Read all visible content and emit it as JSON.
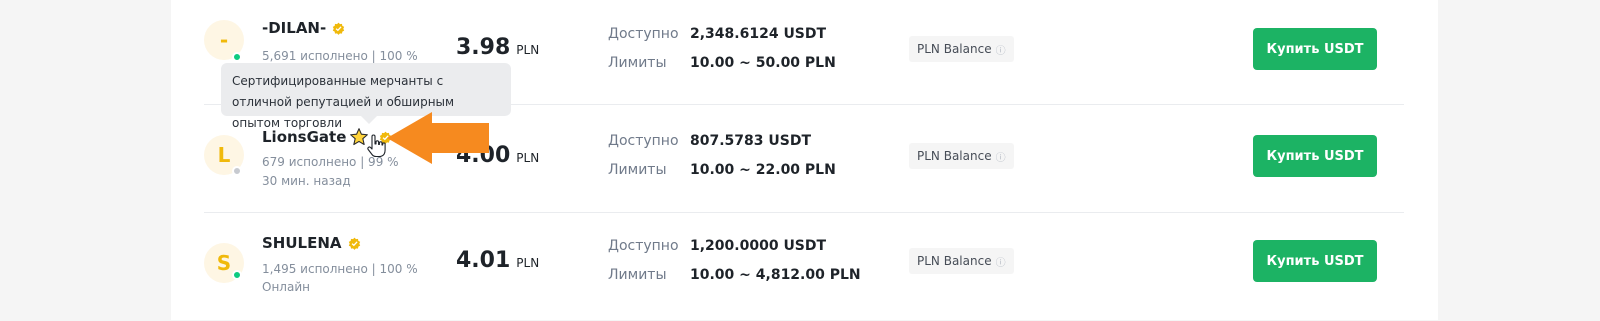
{
  "colors": {
    "accent_green": "#1cb364",
    "badge_gold": "#f0b90b",
    "online": "#0ecb81",
    "offline": "#c7cad0",
    "annotation_arrow": "#f68a1f"
  },
  "labels": {
    "available": "Доступно",
    "limits": "Лимиты",
    "buy_button": "Купить USDT",
    "currency": "PLN",
    "info_icon": "ⓘ"
  },
  "tooltip": {
    "text": "Сертифицированные мерчанты с отличной репутацией и обширным опытом торговли"
  },
  "merchants": [
    {
      "initial": "-",
      "name": "-DILAN-",
      "status": "online",
      "has_star": false,
      "stats": "5,691 исполнено  |  100 %",
      "activity": "",
      "price": "3.98",
      "available": "2,348.6124 USDT",
      "limits": "10.00 ~ 50.00 PLN",
      "payment": "PLN Balance"
    },
    {
      "initial": "L",
      "name": "LionsGate",
      "status": "offline",
      "has_star": true,
      "stats": "679 исполнено  |  99 %",
      "activity": "30 мин. назад",
      "price": "4.00",
      "available": "807.5783 USDT",
      "limits": "10.00 ~ 22.00 PLN",
      "payment": "PLN Balance"
    },
    {
      "initial": "S",
      "name": "SHULENA",
      "status": "online",
      "has_star": false,
      "stats": "1,495 исполнено  |  100 %",
      "activity": "Онлайн",
      "price": "4.01",
      "available": "1,200.0000 USDT",
      "limits": "10.00 ~ 4,812.00 PLN",
      "payment": "PLN Balance"
    }
  ]
}
